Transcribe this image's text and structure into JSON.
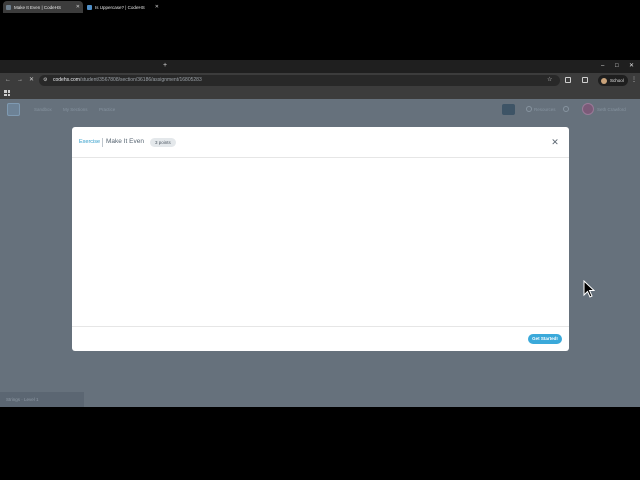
{
  "browser": {
    "tabs": [
      {
        "title": "Make It Even | CodeHS",
        "active": true
      },
      {
        "title": "Is Uppercase? | CodeHS",
        "active": false
      }
    ],
    "new_tab_symbol": "+",
    "window_controls": {
      "minimize": "–",
      "maximize": "□",
      "close": "✕"
    },
    "url": {
      "host": "codehs.com",
      "path": "/student/3567808/section/36186/assignment/16805283"
    },
    "profile_label": "School"
  },
  "site": {
    "nav": [
      "Sandbox",
      "My Sections",
      "Practice"
    ],
    "header_items": [
      "Resources",
      "Seth Crawford"
    ],
    "status_footer": "Strings · Level 1"
  },
  "modal": {
    "kind": "Exercise",
    "title": "Make It Even",
    "points": "3 points",
    "close_symbol": "✕",
    "start_button": "Get Started!"
  },
  "colors": {
    "accent": "#3aa9da",
    "overlay": "#66717c",
    "chrome_dark": "#1f1f1f",
    "chrome_toolbar": "#3c3c3c"
  },
  "icons": [
    "back-arrow-icon",
    "forward-arrow-icon",
    "reload-icon",
    "site-info-icon",
    "bookmark-star-icon",
    "extensions-icon",
    "apps-grid-icon",
    "close-icon",
    "mouse-pointer-icon"
  ]
}
